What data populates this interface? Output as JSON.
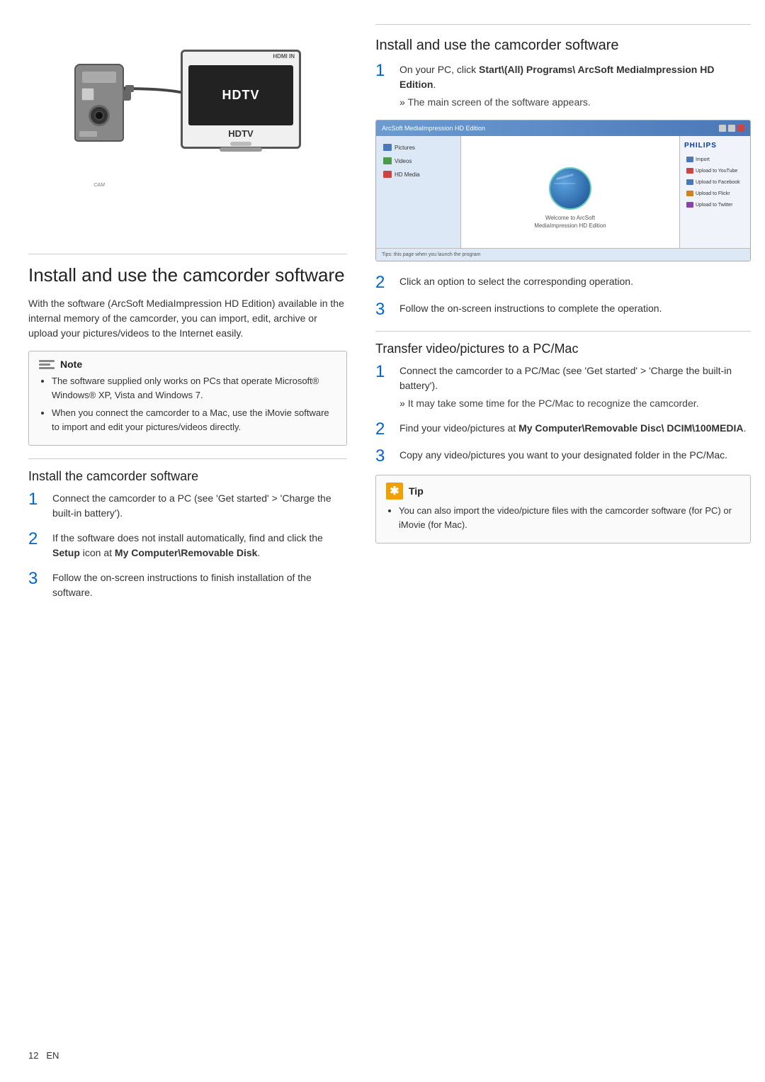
{
  "page": {
    "footer_page": "12",
    "footer_lang": "EN"
  },
  "diagram": {
    "tv_label": "HDTV",
    "hdmi_label": "HDMI IN"
  },
  "left_section_title": "Install and use the camcorder software",
  "intro_text": "With the software (ArcSoft MediaImpression HD Edition) available in the internal memory of the camcorder, you can import, edit, archive or upload your pictures/videos to the Internet easily.",
  "note": {
    "header": "Note",
    "items": [
      "The software supplied only works on PCs that operate Microsoft® Windows® XP, Vista and Windows 7.",
      "When you connect the camcorder to a Mac, use the iMovie software to import and edit your pictures/videos directly."
    ]
  },
  "install_section": {
    "title": "Install the camcorder software",
    "steps": [
      {
        "number": "1",
        "text": "Connect the camcorder to a PC (see 'Get started' > 'Charge the built-in battery')."
      },
      {
        "number": "2",
        "text": "If the software does not install automatically, find and click the ",
        "bold_part": "Setup",
        "text2": " icon at ",
        "bold_part2": "My Computer\\Removable Disk",
        "text3": "."
      },
      {
        "number": "3",
        "text": "Follow the on-screen instructions to finish installation of the software."
      }
    ]
  },
  "right_section": {
    "title": "Install and use the camcorder software",
    "steps": [
      {
        "number": "1",
        "text": "On your PC, click ",
        "bold_part": "Start\\(All) Programs\\ ArcSoft MediaImpression HD Edition",
        "text2": ".",
        "sub_items": [
          "The main screen of the software appears."
        ]
      },
      {
        "number": "2",
        "text": "Click an option to select the corresponding operation."
      },
      {
        "number": "3",
        "text": "Follow the on-screen instructions to complete the operation."
      }
    ],
    "screenshot": {
      "titlebar": "ArcSoft MediaImpression HD Edition",
      "philips_label": "PHILIPS",
      "sidebar_items": [
        "Pictures",
        "Videos",
        "HD Media"
      ],
      "right_buttons": [
        "Import",
        "Upload to YouTube",
        "Upload to Facebook",
        "Upload to Flickr",
        "Upload to Twitter"
      ],
      "bottom_text": "Tips: this page when you launch the program"
    }
  },
  "transfer_section": {
    "title": "Transfer video/pictures to a PC/Mac",
    "steps": [
      {
        "number": "1",
        "text": "Connect the camcorder to a PC/Mac (see 'Get started' > 'Charge the built-in battery').",
        "sub_items": [
          "It may take some time for the PC/Mac to recognize the camcorder."
        ]
      },
      {
        "number": "2",
        "text": "Find your video/pictures at ",
        "bold_part": "My Computer\\Removable Disc\\ DCIM\\100MEDIA",
        "text2": "."
      },
      {
        "number": "3",
        "text": "Copy any video/pictures you want to your designated folder in the PC/Mac."
      }
    ]
  },
  "tip": {
    "header": "Tip",
    "items": [
      "You can also import the video/picture files with the camcorder software (for PC) or iMovie (for Mac)."
    ]
  }
}
